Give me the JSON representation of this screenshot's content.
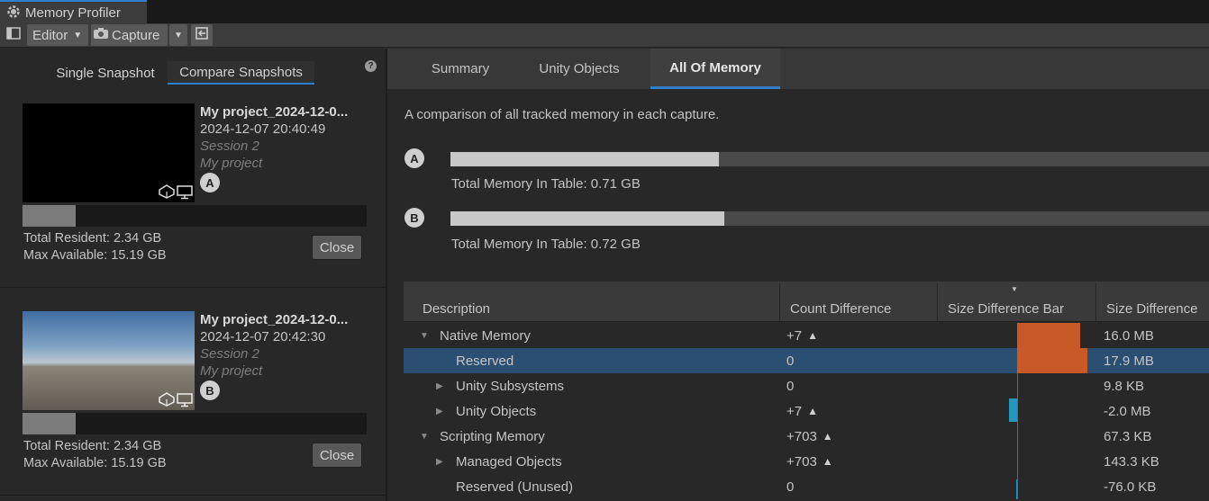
{
  "window": {
    "title": "Memory Profiler"
  },
  "toolbar": {
    "target_label": "Editor",
    "capture_label": "Capture"
  },
  "left": {
    "modes": [
      "Single Snapshot",
      "Compare Snapshots"
    ],
    "snapshots": [
      {
        "badge": "A",
        "name": "My project_2024-12-0...",
        "datetime": "2024-12-07 20:40:49",
        "session": "Session 2",
        "project": "My project",
        "resident_fraction": 0.155,
        "total_resident": "Total Resident: 2.34 GB",
        "max_available": "Max Available: 15.19 GB",
        "close_label": "Close"
      },
      {
        "badge": "B",
        "name": "My project_2024-12-0...",
        "datetime": "2024-12-07 20:42:30",
        "session": "Session 2",
        "project": "My project",
        "resident_fraction": 0.155,
        "total_resident": "Total Resident: 2.34 GB",
        "max_available": "Max Available: 15.19 GB",
        "close_label": "Close"
      }
    ]
  },
  "views": [
    "Summary",
    "Unity Objects",
    "All Of Memory"
  ],
  "main": {
    "description": "A comparison of all tracked memory in each capture.",
    "comparisons": [
      {
        "badge": "A",
        "fill_fraction": 0.354,
        "total_label": "Total Memory In Table: 0.71 GB"
      },
      {
        "badge": "B",
        "fill_fraction": 0.361,
        "total_label": "Total Memory In Table: 0.72 GB"
      }
    ]
  },
  "table": {
    "columns": [
      "Description",
      "Count Difference",
      "Size Difference Bar",
      "Size Difference"
    ],
    "rows": [
      {
        "description": "Native Memory",
        "count": "+7",
        "count_up": true,
        "size": "16.0 MB",
        "expander": "expanded",
        "level": 0,
        "selected": false,
        "bar_delta": 0.62
      },
      {
        "description": "Reserved",
        "count": "0",
        "count_up": false,
        "size": "17.9 MB",
        "expander": "none",
        "level": 1,
        "selected": true,
        "bar_delta": 0.69
      },
      {
        "description": "Unity Subsystems",
        "count": "0",
        "count_up": false,
        "size": "9.8 KB",
        "expander": "collapsed",
        "level": 1,
        "selected": false,
        "bar_delta": 0.0
      },
      {
        "description": "Unity Objects",
        "count": "+7",
        "count_up": true,
        "size": "-2.0 MB",
        "expander": "collapsed",
        "level": 1,
        "selected": false,
        "bar_delta": -0.08
      },
      {
        "description": "Scripting Memory",
        "count": "+703",
        "count_up": true,
        "size": "67.3 KB",
        "expander": "expanded",
        "level": 0,
        "selected": false,
        "bar_delta": 0.0
      },
      {
        "description": "Managed Objects",
        "count": "+703",
        "count_up": true,
        "size": "143.3 KB",
        "expander": "collapsed",
        "level": 1,
        "selected": false,
        "bar_delta": 0.0
      },
      {
        "description": "Reserved (Unused)",
        "count": "0",
        "count_up": false,
        "size": "-76.0 KB",
        "expander": "none",
        "level": 1,
        "selected": false,
        "bar_delta": -0.01
      }
    ]
  },
  "colors": {
    "accent": "#2e7ec9",
    "increase": "#c95a28",
    "decrease": "#2596be",
    "selection": "#2b4f73"
  }
}
